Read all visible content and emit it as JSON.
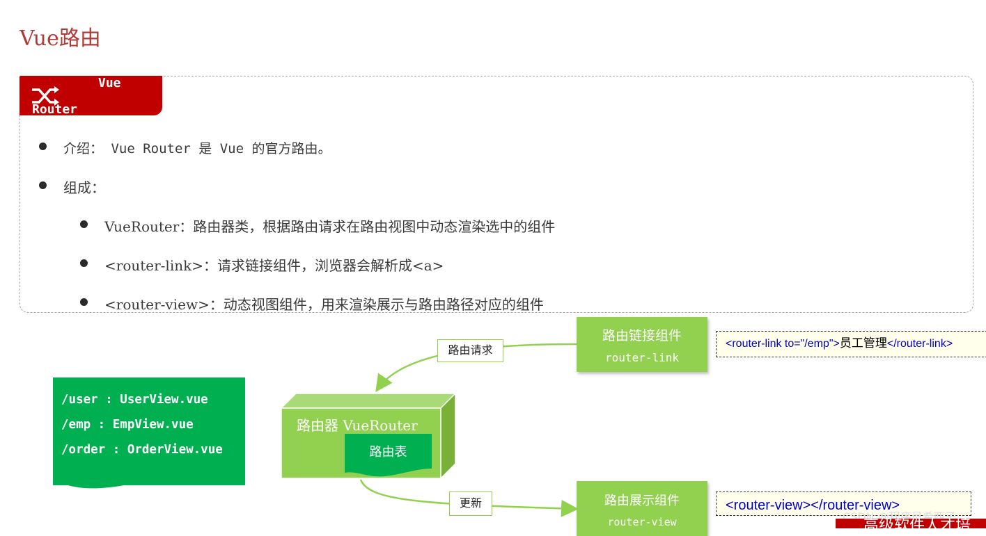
{
  "page": {
    "title": "Vue路由"
  },
  "card": {
    "tag": {
      "line1": "Vue",
      "line2": "Router",
      "icon": "shuffle-icon"
    },
    "bullets": [
      "介绍： Vue Router 是 Vue 的官方路由。",
      "组成："
    ],
    "sub_bullets": [
      "VueRouter：路由器类，根据路由请求在路由视图中动态渲染选中的组件",
      "<router-link>：请求链接组件，浏览器会解析成<a>",
      "<router-view>：动态视图组件，用来渲染展示与路由路径对应的组件"
    ]
  },
  "diagram": {
    "routes": [
      "/user : UserView.vue",
      "/emp : EmpView.vue",
      "/order : OrderView.vue"
    ],
    "router": {
      "title": "路由器 VueRouter",
      "table": "路由表"
    },
    "link_component": {
      "title": "路由链接组件",
      "code": "router-link"
    },
    "view_component": {
      "title": "路由展示组件",
      "code": "router-view"
    },
    "request_label": "路由请求",
    "update_label": "更新",
    "link_snippet": {
      "open": "<router-link to=\"/emp\">",
      "text": "员工管理",
      "close": "</router-link>"
    },
    "view_snippet": "<router-view></router-view>"
  },
  "watermark": "CSDN @程序员希西子",
  "footer_banner": "高级软件人才培"
}
